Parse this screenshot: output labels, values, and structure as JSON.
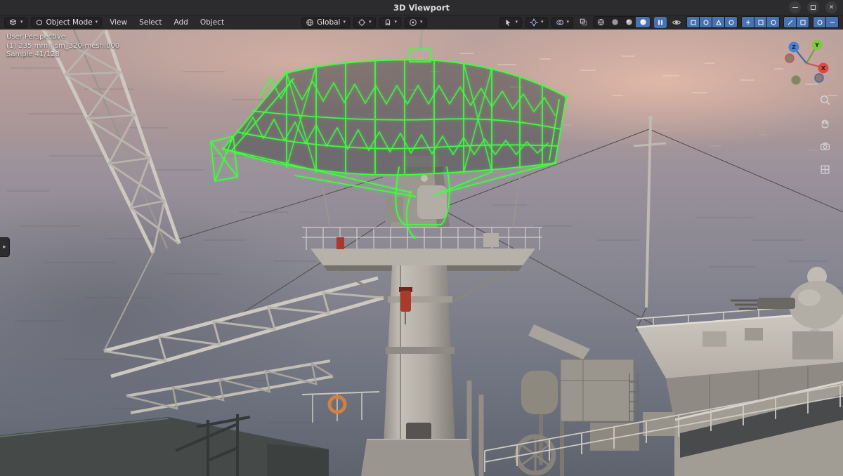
{
  "window": {
    "title": "3D Viewport"
  },
  "header": {
    "mode_label": "Object Mode",
    "menus": [
      "View",
      "Select",
      "Add",
      "Object"
    ],
    "orientation_label": "Global"
  },
  "viewport_overlay": {
    "line1": "User Perspective",
    "line2": "(1) 235 mm | sm_320-mesh.000",
    "line3": "Sample 41/128"
  },
  "colors": {
    "accent_blue": "#4772b3",
    "selection_wire": "#3dff3d",
    "axis_x": "#e0493f",
    "axis_y": "#7fc93c",
    "axis_z": "#4a7fd6"
  }
}
